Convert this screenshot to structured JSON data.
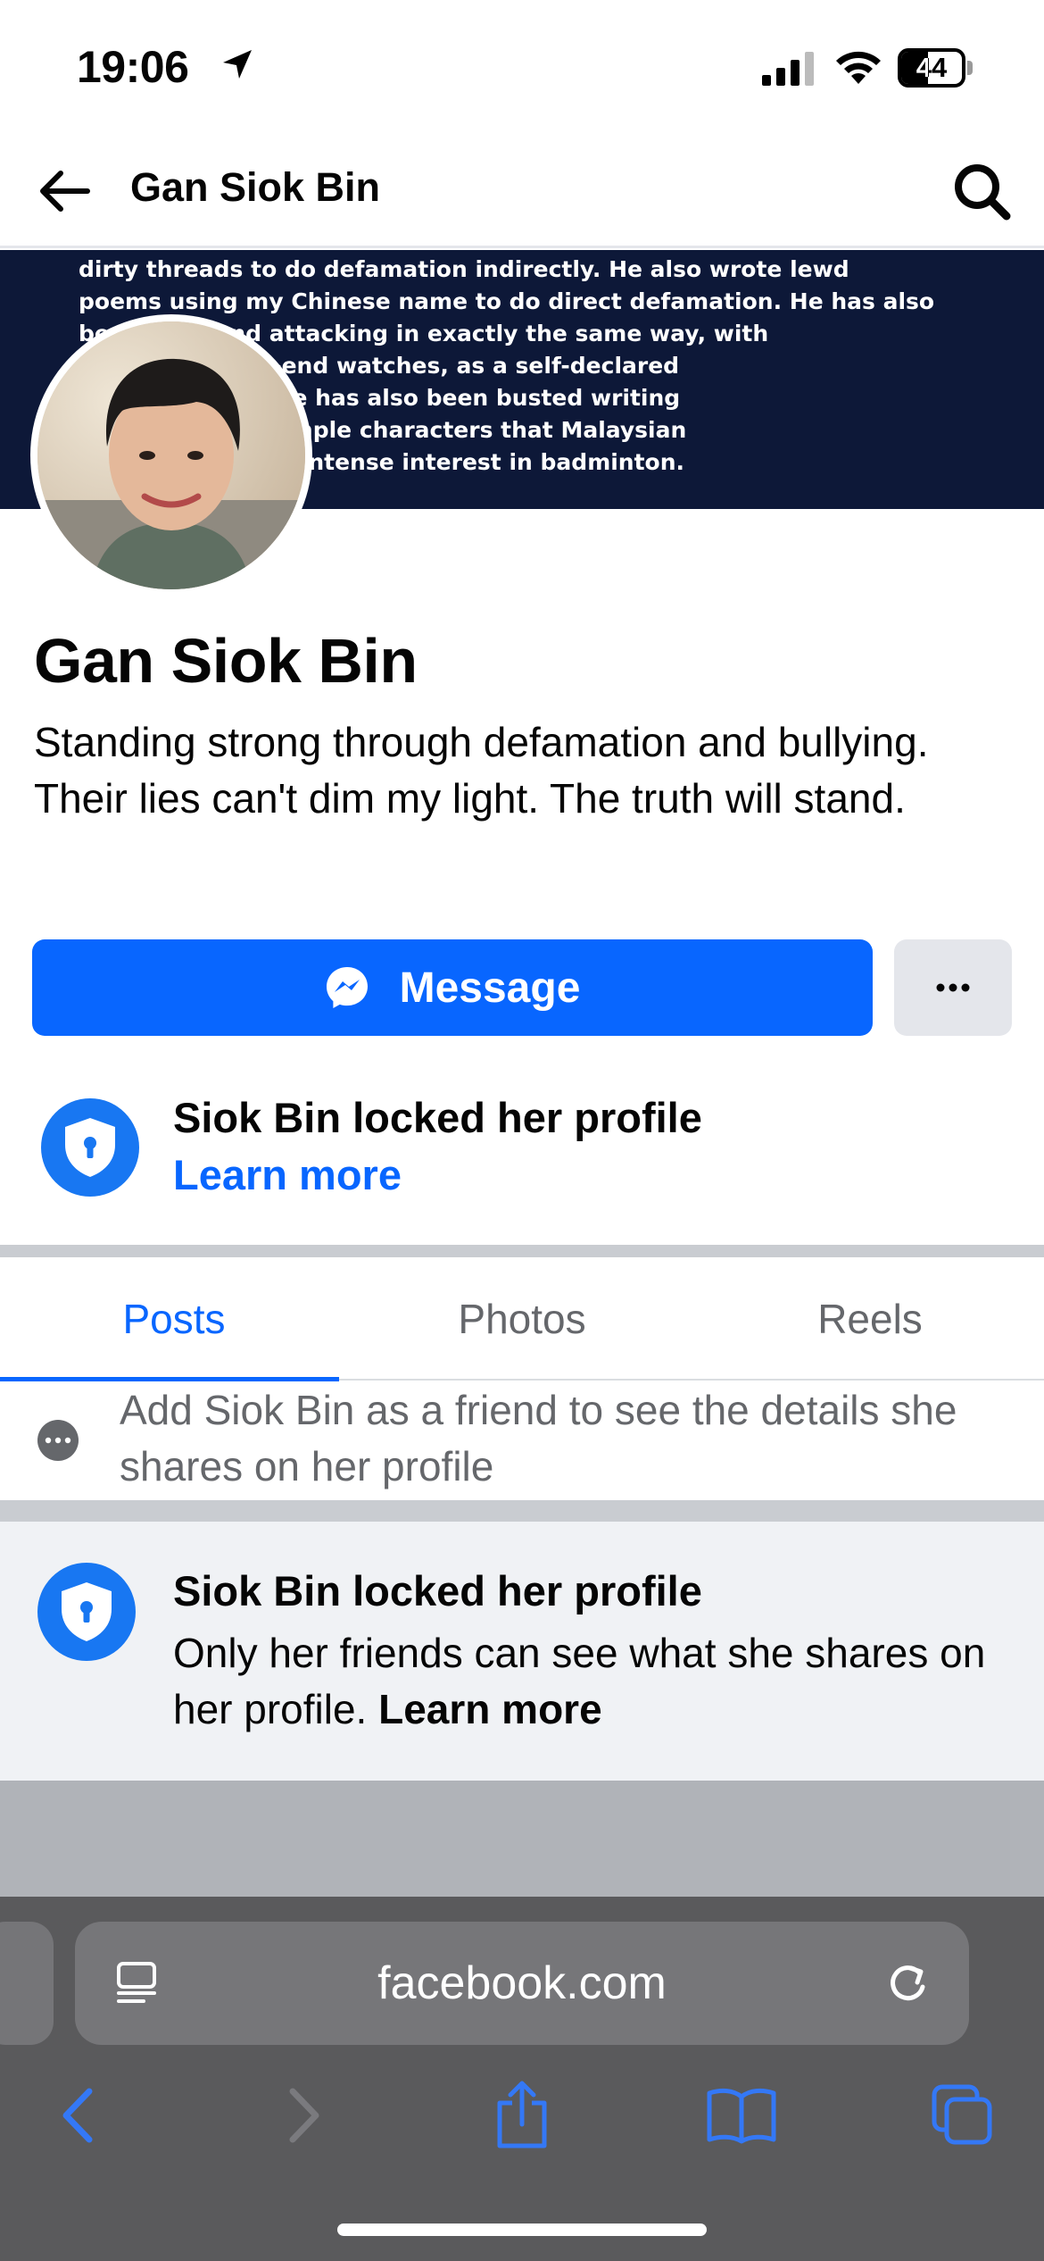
{
  "status_bar": {
    "time": "19:06",
    "battery_percent": "44",
    "battery_level": 0.44
  },
  "header": {
    "title": "Gan Siok Bin"
  },
  "cover": {
    "text": "dirty threads to do defamation indirectly. He also wrote lewd\npoems using my Chinese name to do direct defamation. He has also\nbe            writing and attacking in exactly the same way, with\n                 interest in high-end watches, as a self-declared\n                  e in the forum. He has also been busted writing\n                  e complex and simple characters that Malaysian\n                  , and showing an intense interest in badminton."
  },
  "profile": {
    "name": "Gan Siok Bin",
    "bio": "Standing strong through defamation and bullying. Their lies can't dim my light. The truth will stand."
  },
  "actions": {
    "message_label": "Message"
  },
  "locked_notice": {
    "title": "Siok Bin locked her profile",
    "link": "Learn more"
  },
  "tabs": [
    {
      "label": "Posts",
      "active": true
    },
    {
      "label": "Photos",
      "active": false
    },
    {
      "label": "Reels",
      "active": false
    }
  ],
  "friend_note": {
    "text": "Add Siok Bin as a friend to see the details she shares on her profile"
  },
  "locked_card": {
    "title": "Siok Bin locked her profile",
    "desc": "Only her friends can see what she shares on her profile.",
    "link": "Learn more"
  },
  "browser": {
    "url": "facebook.com"
  },
  "colors": {
    "brand_blue": "#0866ff",
    "cover_bg": "#0d1838",
    "toolbar_bg": "#5a5a5c"
  }
}
